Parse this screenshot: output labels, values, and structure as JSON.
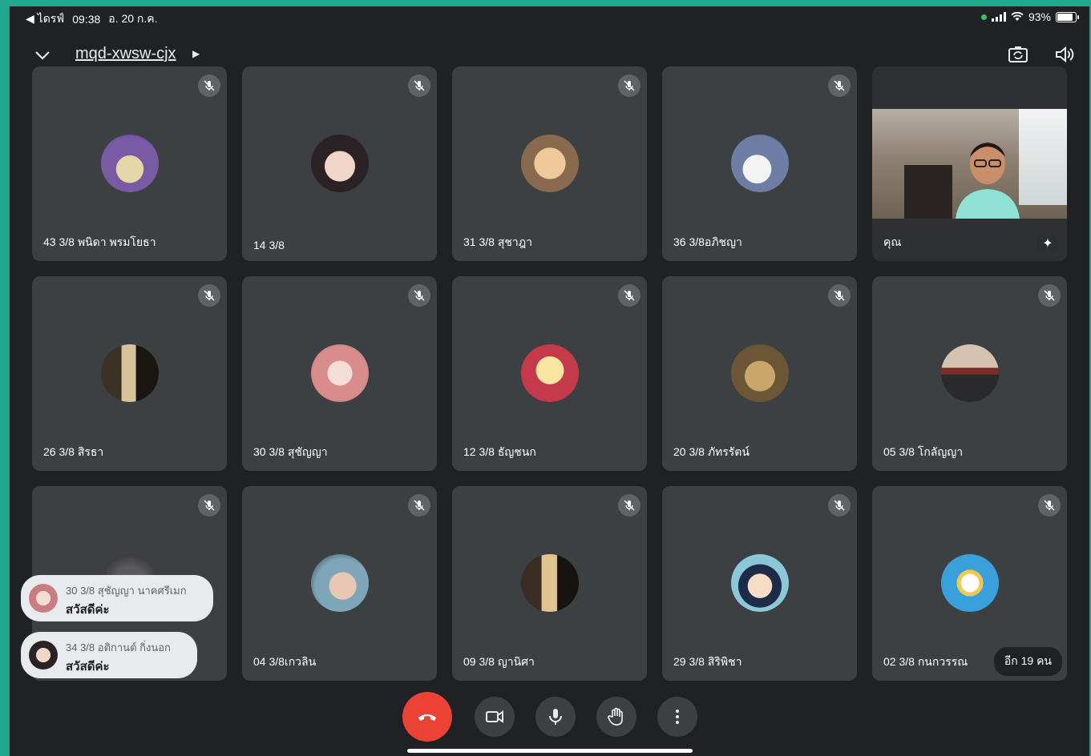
{
  "status_bar": {
    "back_label": "◀ ไดรฟ์",
    "time": "09:38",
    "date": "อ. 20 ก.ค.",
    "battery": "93%"
  },
  "header": {
    "meeting_code": "mqd-xwsw-cjx",
    "icons": [
      "chevron-down-icon",
      "switch-camera-icon",
      "speaker-icon"
    ]
  },
  "tiles": [
    {
      "name": "43 3/8 พนิดา พรมโยธา",
      "muted": true
    },
    {
      "name": "14 3/8",
      "muted": true
    },
    {
      "name": "31 3/8 สุชาฎา",
      "muted": true
    },
    {
      "name": "36 3/8อภิชญา",
      "muted": true
    },
    {
      "name": "คุณ",
      "muted": false,
      "self": true
    },
    {
      "name": "26 3/8 สิรธา",
      "muted": true
    },
    {
      "name": "30 3/8 สุชัญญา",
      "muted": true
    },
    {
      "name": "12 3/8 ธัญชนก",
      "muted": true
    },
    {
      "name": "20 3/8 ภัทรรัตน์",
      "muted": true
    },
    {
      "name": "05 3/8 โกลัญญา",
      "muted": true
    },
    {
      "name": "",
      "muted": true
    },
    {
      "name": "04 3/8เกวลิน",
      "muted": true
    },
    {
      "name": "09 3/8 ญานิศา",
      "muted": true
    },
    {
      "name": "29 3/8 สิริพิชา",
      "muted": true
    },
    {
      "name": "02 3/8 กนกวรรณ",
      "muted": true
    }
  ],
  "more_participants": "อีก 19 คน",
  "chat": [
    {
      "sender": "30 3/8 สุชัญญา นาคศรีเมก",
      "message": "สวัสดีค่ะ"
    },
    {
      "sender": "34 3/8 อติกานต์ กิ่งนอก",
      "message": "สวัสดีค่ะ"
    }
  ],
  "controls": [
    "end-call",
    "camera",
    "microphone",
    "raise-hand",
    "more-options"
  ],
  "colors": {
    "end_call": "#ea4335",
    "tile_bg": "#3c4043",
    "background": "#202124"
  }
}
